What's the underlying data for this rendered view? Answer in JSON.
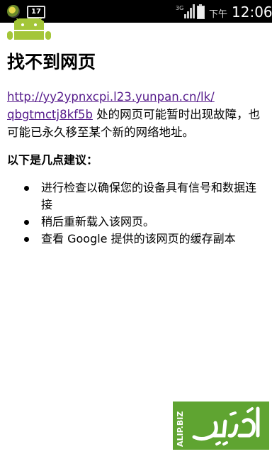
{
  "status_bar": {
    "notification_icons": [
      "app-icon",
      "sim-17-icon"
    ],
    "sim_badge": "17",
    "signal_icon": "signal-3g-icon",
    "battery_icon": "battery-icon",
    "ampm": "下午",
    "time": "12:06"
  },
  "page": {
    "title": "找不到网页",
    "url_part1": "http://yy2ypnxcpi.l23.yunpan.cn/lk/",
    "url_part2": "qbgtmctj8kf5b",
    "description": " 处的网页可能暂时出现故障，也可能已永久移至某个新的网络地址。",
    "suggestions_heading": "以下是几点建议：",
    "suggestions": [
      "进行检查以确保您的设备具有信号和数据连接",
      "稍后重新载入该网页。",
      "查看 Google 提供的该网页的缓存副本"
    ]
  },
  "watermark": {
    "side_text": "ALIP.BIZ",
    "brand_color": "#5fa431"
  },
  "colors": {
    "link_visited": "#551a8b",
    "android_green": "#a4c639"
  }
}
